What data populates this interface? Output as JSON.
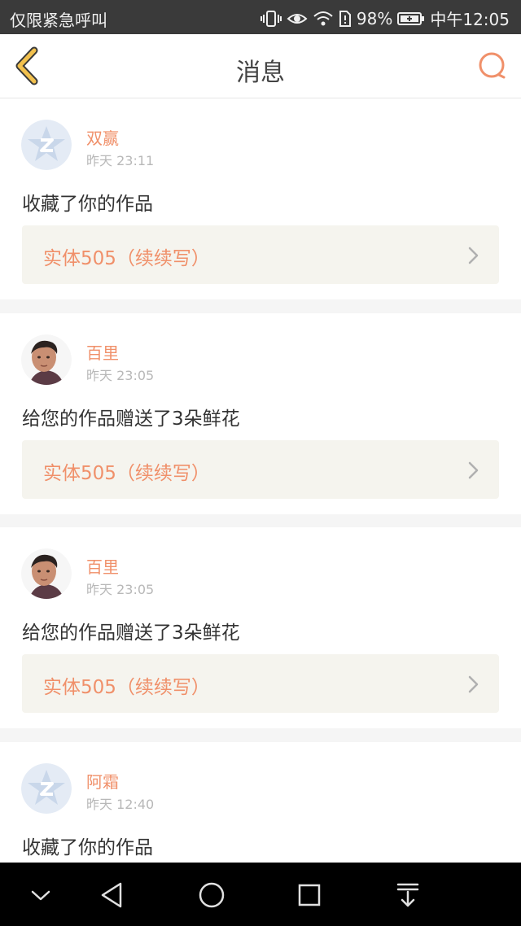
{
  "status_bar": {
    "carrier": "仅限紧急呼叫",
    "battery": "98%",
    "time": "中午12:05",
    "icons": [
      "vibrate-icon",
      "eye-icon",
      "wifi-icon",
      "sim-icon",
      "battery-icon"
    ]
  },
  "header": {
    "title": "消息",
    "back_icon": "chevron-left-icon",
    "search_icon": "search-icon"
  },
  "messages": [
    {
      "name": "双赢",
      "time": "昨天 23:11",
      "text": "收藏了你的作品",
      "work": "实体505（续续写）",
      "avatar": "default-star-avatar"
    },
    {
      "name": "百里",
      "time": "昨天 23:05",
      "text": "给您的作品赠送了3朵鲜花",
      "work": "实体505（续续写）",
      "avatar": "photo-avatar"
    },
    {
      "name": "百里",
      "time": "昨天 23:05",
      "text": "给您的作品赠送了3朵鲜花",
      "work": "实体505（续续写）",
      "avatar": "photo-avatar"
    },
    {
      "name": "阿霜",
      "time": "昨天 12:40",
      "text": "收藏了你的作品",
      "work": "",
      "avatar": "default-star-avatar"
    }
  ],
  "system_nav": [
    "collapse-icon",
    "back-triangle-icon",
    "home-circle-icon",
    "recents-square-icon",
    "notification-pull-icon"
  ],
  "colors": {
    "accent": "#f0906a",
    "back_accent": "#f2c14e",
    "card_bg": "#ffffff",
    "work_bg": "#f5f4ee"
  }
}
